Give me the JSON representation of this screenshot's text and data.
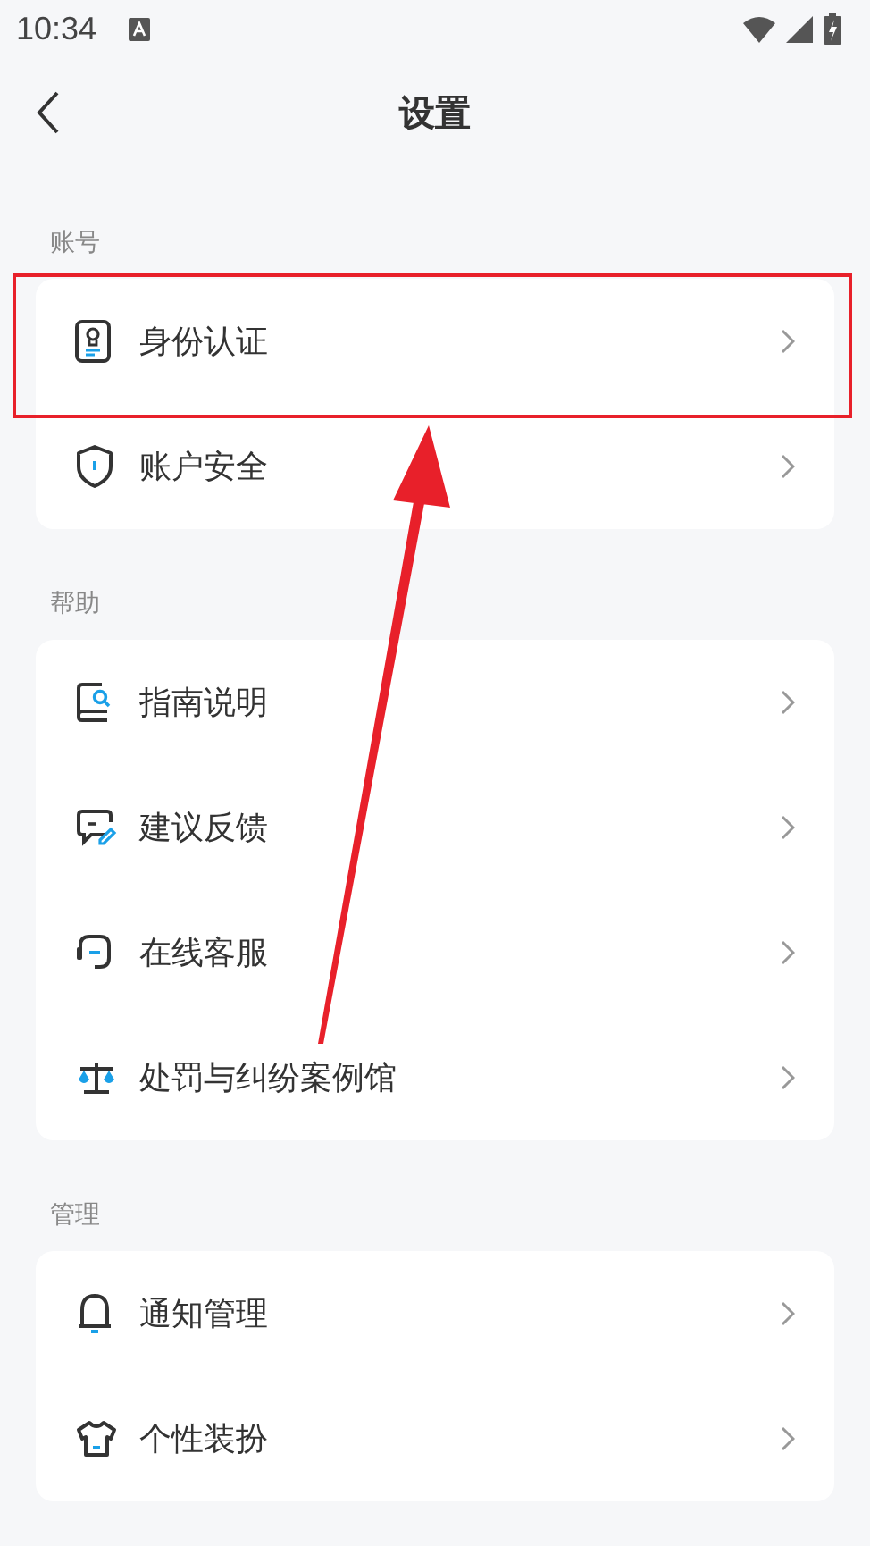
{
  "status_bar": {
    "time": "10:34"
  },
  "header": {
    "title": "设置"
  },
  "sections": [
    {
      "label": "账号",
      "items": [
        {
          "label": "身份认证"
        },
        {
          "label": "账户安全"
        }
      ]
    },
    {
      "label": "帮助",
      "items": [
        {
          "label": "指南说明"
        },
        {
          "label": "建议反馈"
        },
        {
          "label": "在线客服"
        },
        {
          "label": "处罚与纠纷案例馆"
        }
      ]
    },
    {
      "label": "管理",
      "items": [
        {
          "label": "通知管理"
        },
        {
          "label": "个性装扮"
        }
      ]
    }
  ]
}
